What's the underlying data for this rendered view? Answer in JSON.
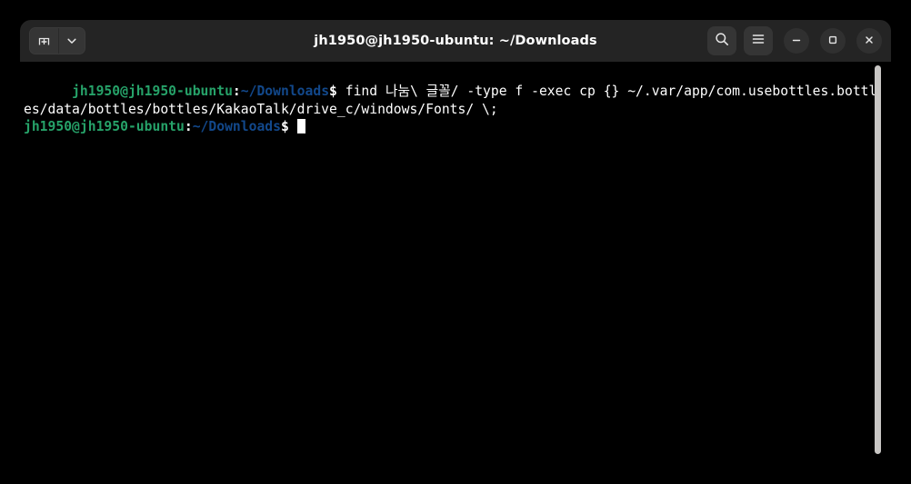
{
  "window": {
    "title": "jh1950@jh1950-ubuntu: ~/Downloads",
    "background_color": "#000000",
    "titlebar_color": "#242424"
  },
  "titlebar": {
    "new_tab_button_label": "New Tab",
    "new_tab_icon": "tab-plus-icon",
    "tab_menu_button_label": "New Tab Options",
    "tab_menu_icon": "chevron-down-icon",
    "search_button_label": "Search",
    "search_icon": "search-icon",
    "menu_button_label": "Main Menu",
    "menu_icon": "hamburger-menu-icon",
    "minimize_button_label": "Minimize",
    "minimize_icon": "minimize-icon",
    "maximize_button_label": "Maximize",
    "maximize_icon": "maximize-icon",
    "close_button_label": "Close",
    "close_icon": "close-icon"
  },
  "terminal": {
    "colors": {
      "user_host": "#26a269",
      "path": "#12488b",
      "foreground": "#ffffff",
      "background": "#000000",
      "cursor": "#ffffff"
    },
    "lines": [
      {
        "user_host": "jh1950@jh1950-ubuntu",
        "separator": ":",
        "path": "~/Downloads",
        "prompt_symbol": "$",
        "command": " find 나눔\\ 글꼴/ -type f -exec cp {} ~/.var/app/com.usebottles.bottles/data/bottles/bottles/KakaoTalk/drive_c/windows/Fonts/ \\;"
      },
      {
        "user_host": "jh1950@jh1950-ubuntu",
        "separator": ":",
        "path": "~/Downloads",
        "prompt_symbol": "$",
        "command": " "
      }
    ]
  },
  "scrollbar": {
    "thumb_color": "#c8c6c4",
    "position": "top"
  }
}
